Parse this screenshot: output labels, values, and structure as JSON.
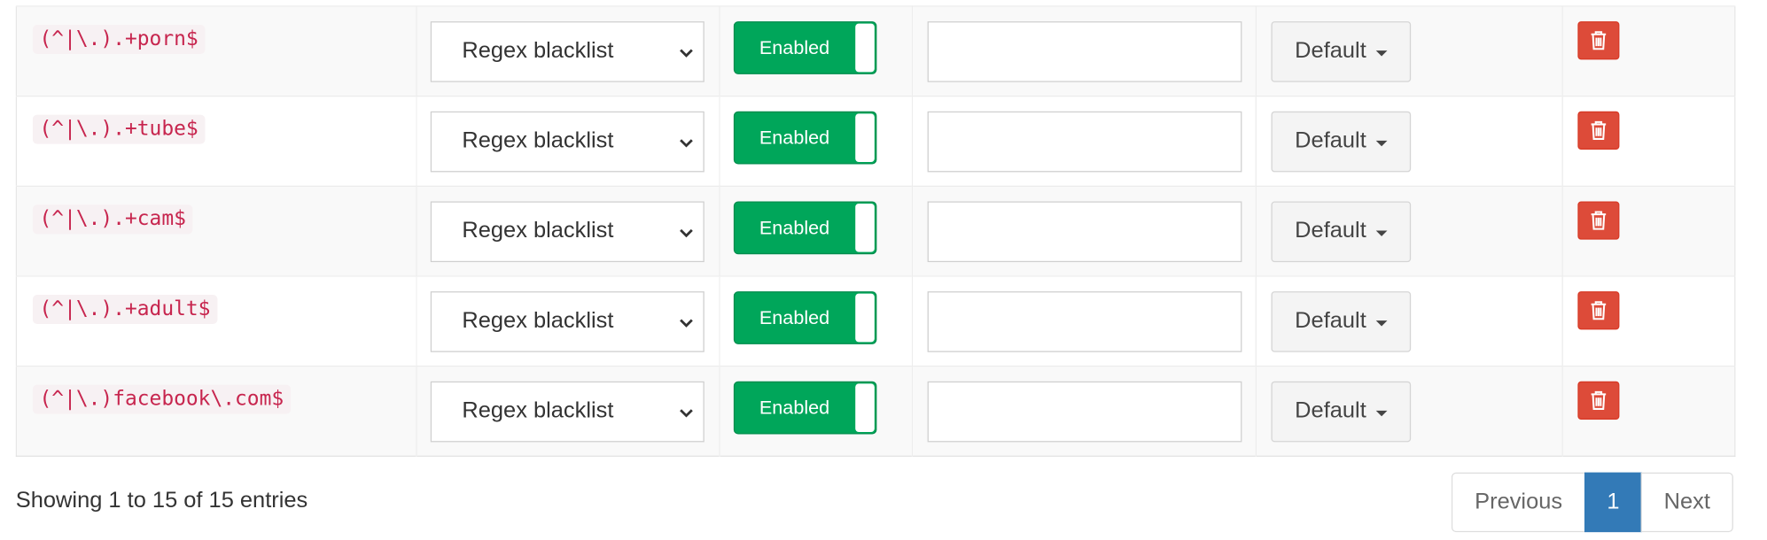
{
  "rows": [
    {
      "domain": "(^|\\.).+porn$",
      "type": "Regex blacklist",
      "status": "Enabled",
      "comment": "",
      "group": "Default"
    },
    {
      "domain": "(^|\\.).+tube$",
      "type": "Regex blacklist",
      "status": "Enabled",
      "comment": "",
      "group": "Default"
    },
    {
      "domain": "(^|\\.).+cam$",
      "type": "Regex blacklist",
      "status": "Enabled",
      "comment": "",
      "group": "Default"
    },
    {
      "domain": "(^|\\.).+adult$",
      "type": "Regex blacklist",
      "status": "Enabled",
      "comment": "",
      "group": "Default"
    },
    {
      "domain": "(^|\\.)facebook\\.com$",
      "type": "Regex blacklist",
      "status": "Enabled",
      "comment": "",
      "group": "Default"
    }
  ],
  "icons": {
    "select": "chevron-down-icon",
    "group": "caret-down-icon",
    "delete": "trash-icon"
  },
  "colors": {
    "enabled": "#00a65a",
    "delete": "#dd4b39",
    "domain_text": "#c7254e",
    "active_page": "#337ab7"
  },
  "footer": {
    "info": "Showing 1 to 15 of 15 entries",
    "previous": "Previous",
    "current_page": "1",
    "next": "Next"
  }
}
